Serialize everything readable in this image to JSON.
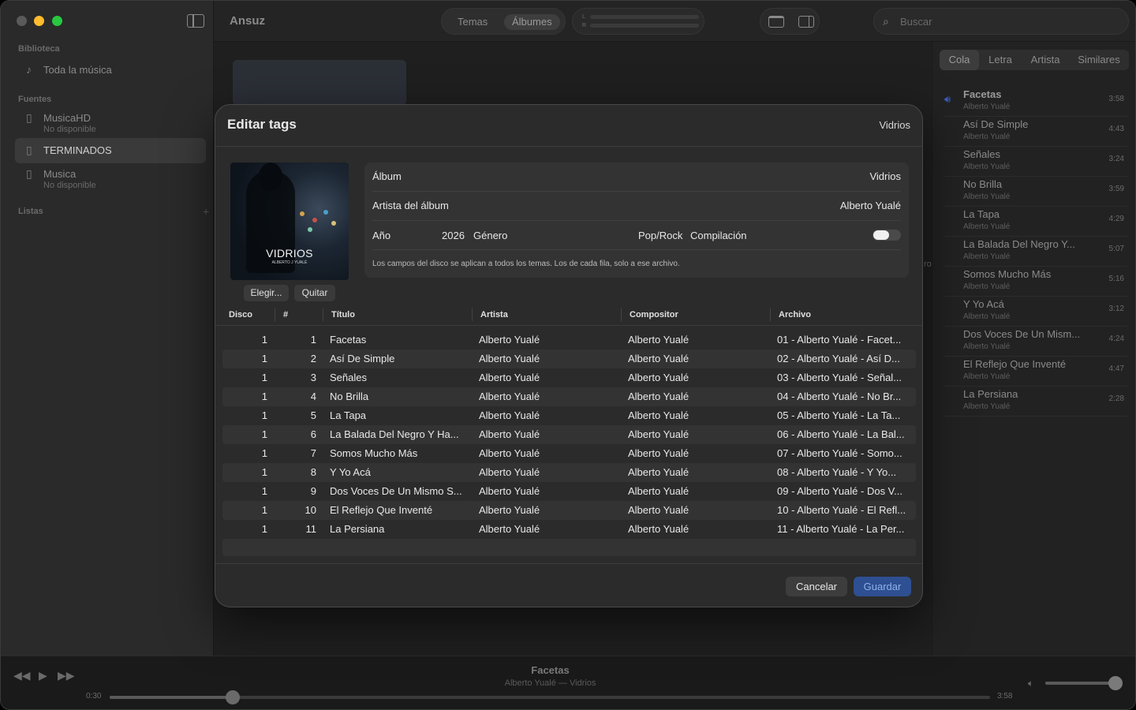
{
  "app": {
    "title": "Ansuz"
  },
  "sidebar": {
    "library_label": "Biblioteca",
    "all_music": "Toda la música",
    "sources_label": "Fuentes",
    "sources": [
      {
        "name": "MusicaHD",
        "status": "No disponible"
      },
      {
        "name": "TERMINADOS",
        "status": ""
      },
      {
        "name": "Musica",
        "status": "No disponible"
      }
    ],
    "lists_label": "Listas",
    "add_symbol": "+"
  },
  "toolbar": {
    "view_tabs": [
      "Temas",
      "Álbumes"
    ],
    "active_view": "Álbumes",
    "meter_labels": [
      "L",
      "R"
    ],
    "search_placeholder": "Buscar"
  },
  "right_panel": {
    "tabs": [
      "Cola",
      "Letra",
      "Artista",
      "Similares"
    ],
    "active_tab": "Cola",
    "queue": [
      {
        "title": "Facetas",
        "artist": "Alberto Yualé",
        "duration": "3:58",
        "playing": true
      },
      {
        "title": "Así De Simple",
        "artist": "Alberto Yualé",
        "duration": "4:43"
      },
      {
        "title": "Señales",
        "artist": "Alberto Yualé",
        "duration": "3:24"
      },
      {
        "title": "No Brilla",
        "artist": "Alberto Yualé",
        "duration": "3:59"
      },
      {
        "title": "La Tapa",
        "artist": "Alberto Yualé",
        "duration": "4:29"
      },
      {
        "title": "La Balada Del Negro Y...",
        "artist": "Alberto Yualé",
        "duration": "5:07"
      },
      {
        "title": "Somos Mucho Más",
        "artist": "Alberto Yualé",
        "duration": "5:16"
      },
      {
        "title": "Y Yo Acá",
        "artist": "Alberto Yualé",
        "duration": "3:12"
      },
      {
        "title": "Dos Voces De Un Mism...",
        "artist": "Alberto Yualé",
        "duration": "4:24"
      },
      {
        "title": "El Reflejo Que Inventé",
        "artist": "Alberto Yualé",
        "duration": "4:47"
      },
      {
        "title": "La Persiana",
        "artist": "Alberto Yualé",
        "duration": "2:28"
      }
    ]
  },
  "background": {
    "partial_text": "ro"
  },
  "modal": {
    "title": "Editar tags",
    "album_name_header": "Vidrios",
    "cover": {
      "title": "VIDRIOS",
      "subtitle": "ALBERTO J YUALÉ"
    },
    "choose_label": "Elegir...",
    "remove_label": "Quitar",
    "fields": {
      "album_label": "Álbum",
      "album_value": "Vidrios",
      "album_artist_label": "Artista del álbum",
      "album_artist_value": "Alberto Yualé",
      "year_label": "Año",
      "year_value": "2026",
      "genre_label": "Género",
      "genre_value": "Pop/Rock",
      "compilation_label": "Compilación",
      "compilation_on": false
    },
    "note": "Los campos del disco se aplican a todos los temas. Los de cada fila, solo a ese archivo.",
    "columns": [
      "Disco",
      "#",
      "Título",
      "Artista",
      "Compositor",
      "Archivo"
    ],
    "rows": [
      {
        "disc": "1",
        "num": "1",
        "title": "Facetas",
        "artist": "Alberto Yualé",
        "composer": "Alberto Yualé",
        "file": "01 - Alberto Yualé - Facet..."
      },
      {
        "disc": "1",
        "num": "2",
        "title": "Así De Simple",
        "artist": "Alberto Yualé",
        "composer": "Alberto Yualé",
        "file": "02 - Alberto Yualé - Así D..."
      },
      {
        "disc": "1",
        "num": "3",
        "title": "Señales",
        "artist": "Alberto Yualé",
        "composer": "Alberto Yualé",
        "file": "03 - Alberto Yualé - Señal..."
      },
      {
        "disc": "1",
        "num": "4",
        "title": "No Brilla",
        "artist": "Alberto Yualé",
        "composer": "Alberto Yualé",
        "file": "04 - Alberto Yualé - No Br..."
      },
      {
        "disc": "1",
        "num": "5",
        "title": "La Tapa",
        "artist": "Alberto Yualé",
        "composer": "Alberto Yualé",
        "file": "05 - Alberto Yualé - La Ta..."
      },
      {
        "disc": "1",
        "num": "6",
        "title": "La Balada Del Negro Y Ha...",
        "artist": "Alberto Yualé",
        "composer": "Alberto Yualé",
        "file": "06 - Alberto Yualé - La Bal..."
      },
      {
        "disc": "1",
        "num": "7",
        "title": "Somos Mucho Más",
        "artist": "Alberto Yualé",
        "composer": "Alberto Yualé",
        "file": "07 - Alberto Yualé - Somo..."
      },
      {
        "disc": "1",
        "num": "8",
        "title": "Y Yo Acá",
        "artist": "Alberto Yualé",
        "composer": "Alberto Yualé",
        "file": "08 - Alberto Yualé - Y Yo..."
      },
      {
        "disc": "1",
        "num": "9",
        "title": "Dos Voces De Un Mismo S...",
        "artist": "Alberto Yualé",
        "composer": "Alberto Yualé",
        "file": "09 - Alberto Yualé - Dos V..."
      },
      {
        "disc": "1",
        "num": "10",
        "title": "El Reflejo Que Inventé",
        "artist": "Alberto Yualé",
        "composer": "Alberto Yualé",
        "file": "10 - Alberto Yualé - El Refl..."
      },
      {
        "disc": "1",
        "num": "11",
        "title": "La Persiana",
        "artist": "Alberto Yualé",
        "composer": "Alberto Yualé",
        "file": "11 - Alberto Yualé - La Per..."
      }
    ],
    "cancel_label": "Cancelar",
    "save_label": "Guardar"
  },
  "player": {
    "title": "Facetas",
    "subtitle": "Alberto Yualé — Vidrios",
    "elapsed": "0:30",
    "total": "3:58",
    "progress_fraction": 0.14,
    "volume_fraction": 0.97
  },
  "colors": {
    "accent": "#2e4f91",
    "speaker": "#3d5fbf",
    "close": "#5a5a5a",
    "minimize": "#febc2e",
    "maximize": "#28c840"
  }
}
